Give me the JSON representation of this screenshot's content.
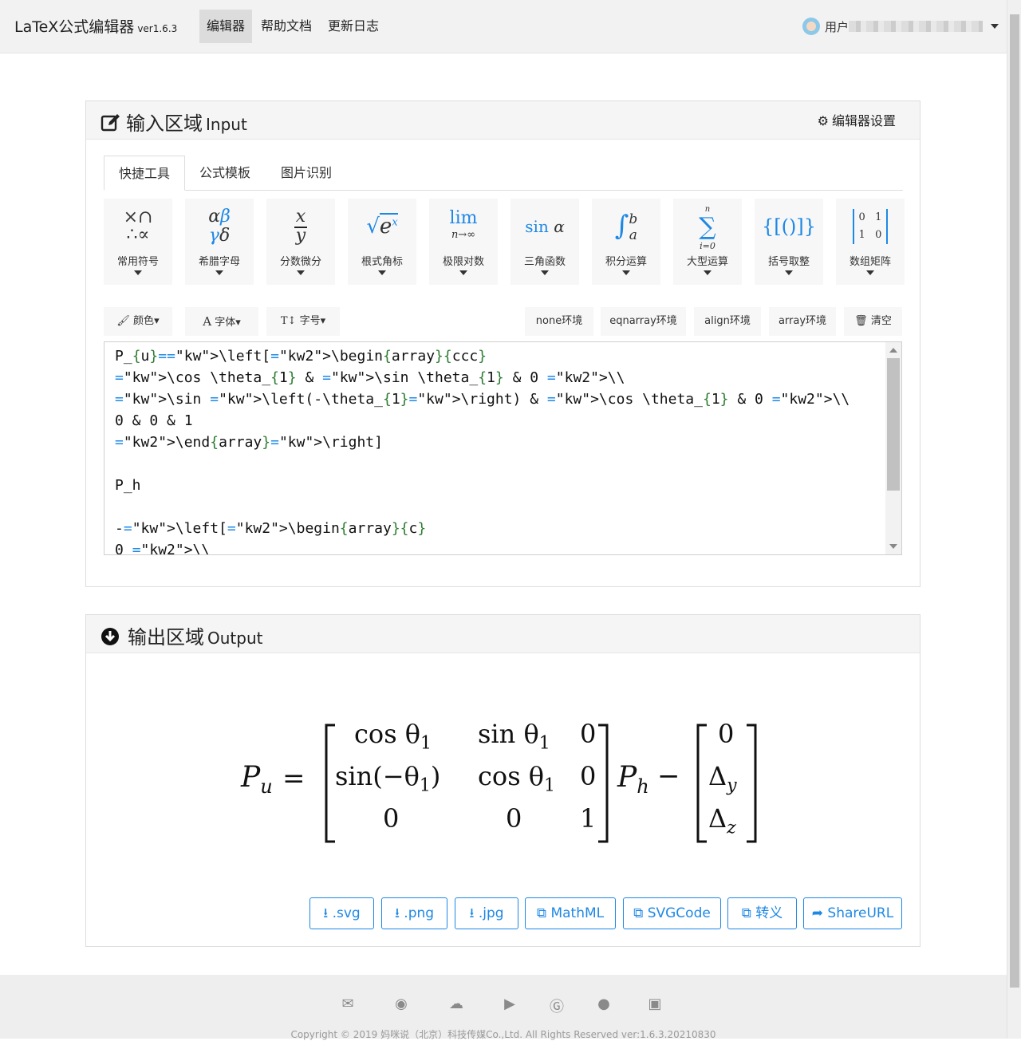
{
  "navbar": {
    "brand": "LaTeX公式编辑器",
    "version": "ver1.6.3",
    "items": [
      "编辑器",
      "帮助文档",
      "更新日志"
    ],
    "user_prefix": "用户"
  },
  "input_panel": {
    "title": "输入区域",
    "title_en": "Input",
    "settings_label": "编辑器设置",
    "tabs": [
      "快捷工具",
      "公式模板",
      "图片识别"
    ],
    "tools": [
      {
        "label": "常用符号"
      },
      {
        "label": "希腊字母"
      },
      {
        "label": "分数微分"
      },
      {
        "label": "根式角标"
      },
      {
        "label": "极限对数"
      },
      {
        "label": "三角函数"
      },
      {
        "label": "积分运算"
      },
      {
        "label": "大型运算"
      },
      {
        "label": "括号取整"
      },
      {
        "label": "数组矩阵"
      }
    ],
    "format_buttons": {
      "color": "颜色",
      "font": "字体",
      "size": "字号"
    },
    "env_buttons": [
      "none环境",
      "eqnarray环境",
      "align环境",
      "array环境"
    ],
    "clear_label": "清空",
    "code_lines": [
      "P_{u}=\\left[\\begin{array}{ccc}",
      "\\cos \\theta_{1} & \\sin \\theta_{1} & 0 \\\\",
      "\\sin \\left(-\\theta_{1}\\right) & \\cos \\theta_{1} & 0 \\\\",
      "0 & 0 & 1",
      "\\end{array}\\right]",
      "",
      "P_h",
      "",
      "-\\left[\\begin{array}{c}",
      "0 \\\\"
    ]
  },
  "output_panel": {
    "title": "输出区域",
    "title_en": "Output",
    "formula": {
      "lhs_var": "P",
      "lhs_sub": "u",
      "m11": "cos θ",
      "m12": "sin θ",
      "m13": "0",
      "m21": "sin(−θ",
      "m22": "cos θ",
      "m23": "0",
      "m31": "0",
      "m32": "0",
      "m33": "1",
      "one": "1",
      "ph_var": "P",
      "ph_sub": "h",
      "v1": "0",
      "v2": "Δ",
      "v2_sub": "y",
      "v3": "Δ",
      "v3_sub": "z"
    },
    "buttons": [
      ".svg",
      ".png",
      ".jpg",
      "MathML",
      "SVGCode",
      "转义",
      "ShareURL"
    ]
  },
  "footer": {
    "icons": [
      "mail-icon",
      "weibo-icon",
      "wechat-icon",
      "play-icon",
      "google-icon",
      "github-icon",
      "youtube-icon"
    ],
    "copyright": "Copyright © 2019 妈咪说（北京）科技传媒Co.,Ltd. All Rights Reserved  ver:1.6.3.20210830"
  }
}
